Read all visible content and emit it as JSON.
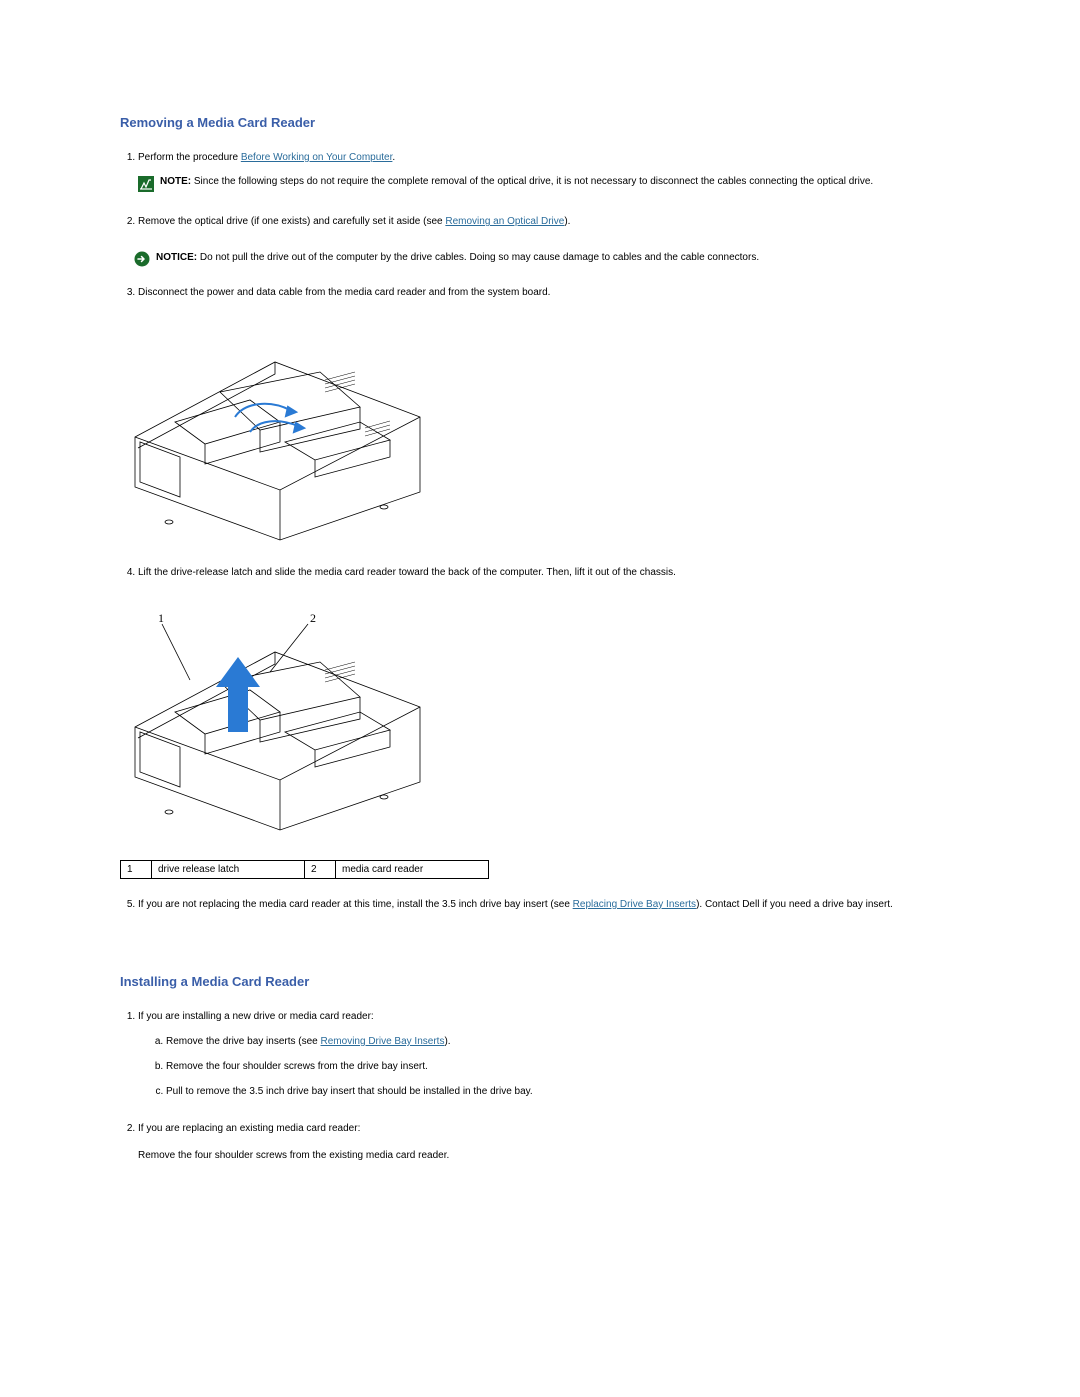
{
  "section1": {
    "title": "Removing a Media Card Reader",
    "steps": {
      "s1_pre": "Perform the procedure ",
      "s1_link": "Before Working on Your Computer",
      "s1_post": ".",
      "note_label": "NOTE:",
      "note_text": " Since the following steps do not require the complete removal of the optical drive, it is not necessary to disconnect the cables connecting the optical drive.",
      "s2_pre": "Remove the optical drive (if one exists) and carefully set it aside (see ",
      "s2_link": "Removing an Optical Drive",
      "s2_post": ").",
      "notice_label": "NOTICE:",
      "notice_text": " Do not pull the drive out of the computer by the drive cables. Doing so may cause damage to cables and the cable connectors.",
      "s3": "Disconnect the power and data cable from the media card reader and from the system board.",
      "s4": "Lift the drive-release latch and slide the media card reader toward the back of the computer. Then, lift it out of the chassis.",
      "s5_pre": "If you are not replacing the media card reader at this time, install the 3.5 inch drive bay insert (see ",
      "s5_link": "Replacing Drive Bay Inserts",
      "s5_post": "). Contact Dell if you need a drive bay insert."
    },
    "table": {
      "n1": "1",
      "t1": "drive release latch",
      "n2": "2",
      "t2": "media card reader"
    }
  },
  "section2": {
    "title": "Installing a Media Card Reader",
    "s1": "If you are installing a new drive or media card reader:",
    "s1a_pre": "Remove the drive bay inserts (see ",
    "s1a_link": "Removing Drive Bay Inserts",
    "s1a_post": ").",
    "s1b": "Remove the four shoulder screws from the drive bay insert.",
    "s1c": "Pull to remove the 3.5 inch drive bay insert that should be installed in the drive bay.",
    "s2": "If you are replacing an existing media card reader:",
    "s2_text": "Remove the four shoulder screws from the existing media card reader."
  },
  "callouts": {
    "c1": "1",
    "c2": "2"
  }
}
